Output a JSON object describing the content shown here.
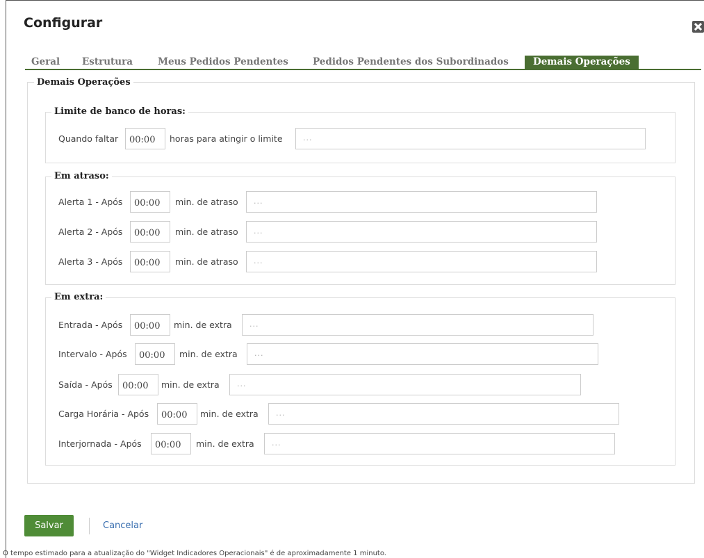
{
  "dialog": {
    "title": "Configurar"
  },
  "icons": {
    "close": "close-icon"
  },
  "tabs": [
    {
      "label": "Geral",
      "active": false
    },
    {
      "label": "Estrutura",
      "active": false
    },
    {
      "label": "Meus Pedidos Pendentes",
      "active": false
    },
    {
      "label": "Pedidos Pendentes dos Subordinados",
      "active": false
    },
    {
      "label": "Demais Operações",
      "active": true
    }
  ],
  "section": {
    "legend": "Demais Operações",
    "banco_horas": {
      "legend": "Limite de banco de horas:",
      "row": {
        "prefix": "Quando faltar",
        "time": "00:00",
        "suffix": "horas para atingir o limite",
        "value": "..."
      }
    },
    "atraso": {
      "legend": "Em atraso:",
      "rows": [
        {
          "prefix": "Alerta 1 - Após",
          "time": "00:00",
          "suffix": "min. de atraso",
          "value": "..."
        },
        {
          "prefix": "Alerta 2 - Após",
          "time": "00:00",
          "suffix": "min. de atraso",
          "value": "..."
        },
        {
          "prefix": "Alerta 3 - Após",
          "time": "00:00",
          "suffix": "min. de atraso",
          "value": "..."
        }
      ]
    },
    "extra": {
      "legend": "Em extra:",
      "rows": [
        {
          "prefix": "Entrada - Após",
          "time": "00:00",
          "suffix": "min. de extra",
          "value": "..."
        },
        {
          "prefix": "Intervalo - Após",
          "time": "00:00",
          "suffix": "min. de extra",
          "value": "..."
        },
        {
          "prefix": "Saída - Após",
          "time": "00:00",
          "suffix": "min. de extra",
          "value": "..."
        },
        {
          "prefix": "Carga Horária - Após",
          "time": "00:00",
          "suffix": "min. de extra",
          "value": "..."
        },
        {
          "prefix": "Interjornada - Após",
          "time": "00:00",
          "suffix": "min. de extra",
          "value": "..."
        }
      ]
    }
  },
  "actions": {
    "save": "Salvar",
    "cancel": "Cancelar"
  },
  "footnote": "O tempo estimado para a atualização do \"Widget Indicadores Operacionais\" é de aproximadamente 1 minuto.",
  "colors": {
    "accent": "#4a6e32",
    "save_button": "#4f8c37",
    "link": "#3a6fb0"
  }
}
